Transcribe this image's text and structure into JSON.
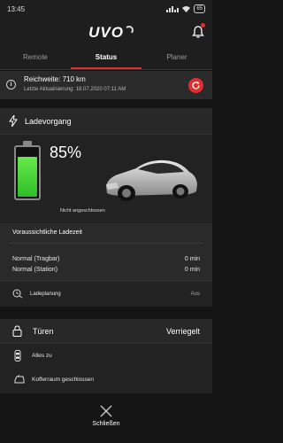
{
  "statusbar": {
    "time": "13:45",
    "battery": "65"
  },
  "header": {
    "logo": "UVO"
  },
  "tabs": [
    {
      "label": "Remote",
      "active": false
    },
    {
      "label": "Status",
      "active": true
    },
    {
      "label": "Planer",
      "active": false
    }
  ],
  "range": {
    "range_text": "Reichweite: 710 km",
    "update_text": "Letzte Aktualisierung: 18.07.2020 07:11 AM"
  },
  "charging": {
    "title": "Ladevorgang",
    "percent_text": "85%",
    "level": 0.85,
    "plug_status": "Nicht angeschlossen",
    "time_header": "Voraussichtliche Ladezeit",
    "rows": [
      {
        "label": "Normal (Tragbar)",
        "value": "0 min"
      },
      {
        "label": "Normal (Station)",
        "value": "0 min"
      }
    ],
    "planning_label": "Ladeplanung",
    "planning_value": "Aus"
  },
  "doors": {
    "title": "Türen",
    "status": "Verriegelt",
    "rows": [
      {
        "label": "Alles zu",
        "icon": "car-doors-icon"
      },
      {
        "label": "Kofferraum geschlossen",
        "icon": "trunk-icon"
      }
    ]
  },
  "footer": {
    "close_label": "Schließen"
  },
  "colors": {
    "accent": "#e02d2d",
    "battery_green": "#4cd43a",
    "background": "#141414"
  }
}
